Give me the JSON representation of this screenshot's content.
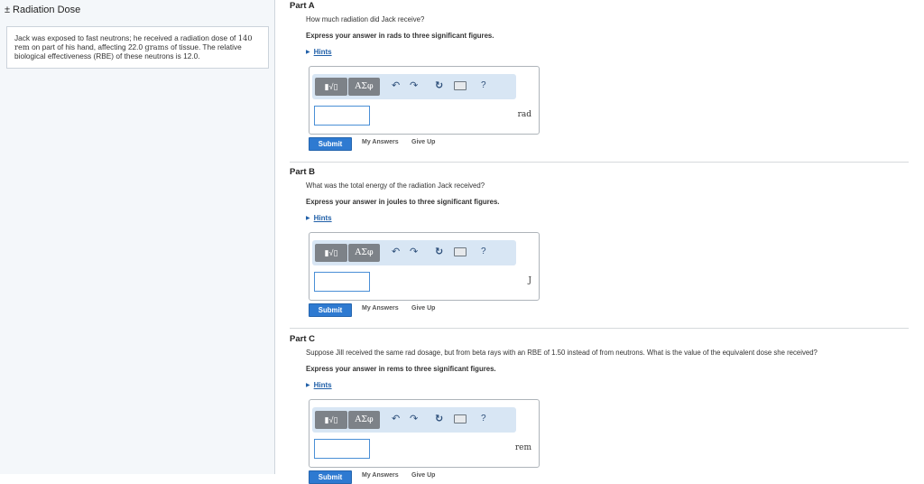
{
  "sidebar": {
    "title_prefix": "±",
    "title": "Radiation Dose",
    "problem": {
      "t1": "Jack was exposed to fast neutrons; he received a radiation dose of",
      "v1": "140",
      "u1": "rem",
      "t2": "on part of his hand, affecting",
      "v2": "22.0",
      "u2": "grams",
      "t3": "of tissue. The relative biological effectiveness (RBE) of these neutrons is 12.0."
    }
  },
  "toolbar": {
    "template_label": "▮√▯",
    "symbols_label": "ΑΣφ",
    "undo": "↶",
    "redo": "↷",
    "reset": "↻",
    "help": "?"
  },
  "common": {
    "hints_label": "Hints",
    "hints_arrow": "▶",
    "submit_label": "Submit",
    "my_answers_label": "My Answers",
    "give_up_label": "Give Up"
  },
  "parts": [
    {
      "title": "Part A",
      "question": "How much radiation did Jack receive?",
      "instruction": "Express your answer in rads to three significant figures.",
      "unit": "rad"
    },
    {
      "title": "Part B",
      "question": "What was the total energy of the radiation Jack received?",
      "instruction": "Express your answer in joules to three significant figures.",
      "unit": "J"
    },
    {
      "title": "Part C",
      "question": "Suppose Jill received the same rad dosage, but from beta rays with an RBE of 1.50 instead of from neutrons. What is the value of the equivalent dose she received?",
      "instruction": "Express your answer in rems to three significant figures.",
      "unit": "rem"
    }
  ]
}
